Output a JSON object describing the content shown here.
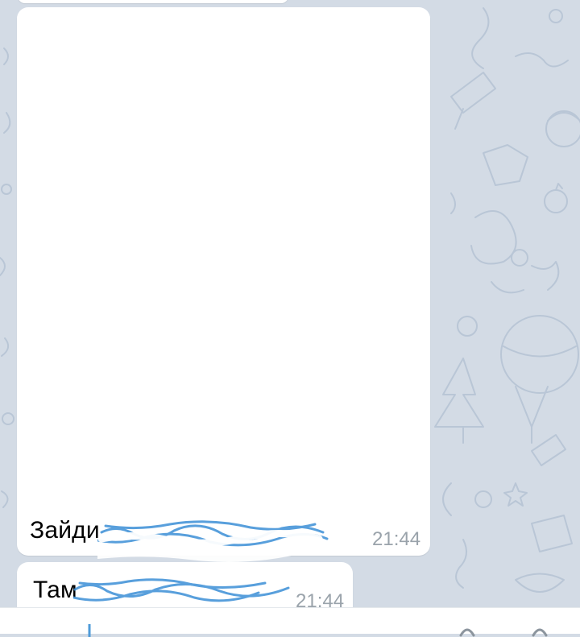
{
  "colors": {
    "wallpaper": "#d3dbe5",
    "bubble": "#ffffff",
    "time": "#9aa3ab",
    "doodle": "#aab8cc",
    "scribble": "#3b8fd6"
  },
  "messages": [
    {
      "text": "Зайди",
      "time": "21:44"
    },
    {
      "text": "Там",
      "time": "21:44"
    }
  ],
  "input_bar": {
    "icons": [
      "attach-icon",
      "emoji-icon",
      "microphone-icon"
    ]
  }
}
